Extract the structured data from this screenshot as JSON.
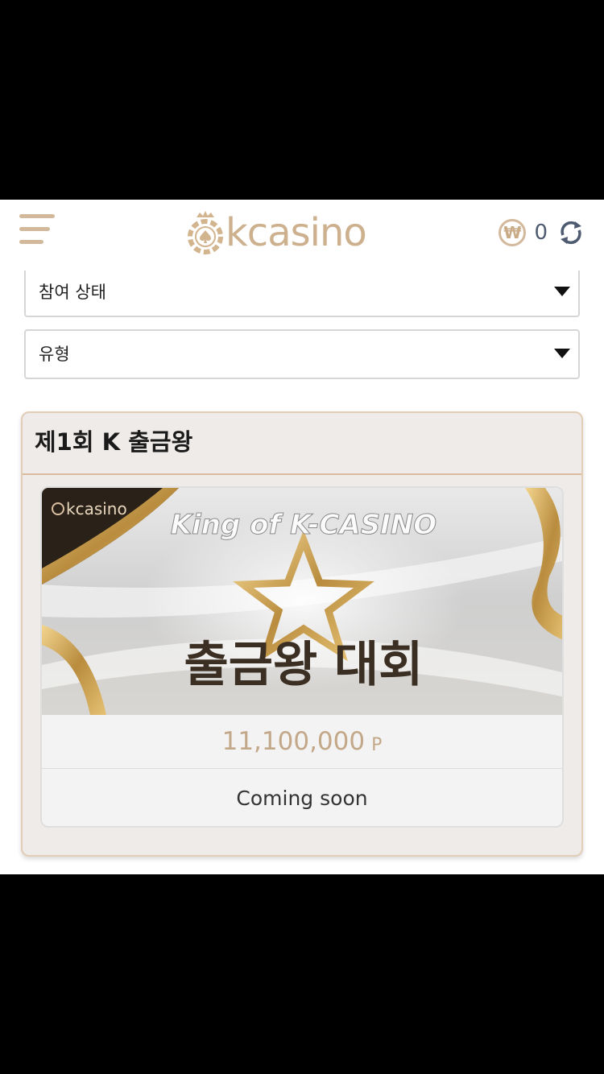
{
  "header": {
    "logo_text": "kcasino",
    "currency_symbol": "₩",
    "balance": "0"
  },
  "filters": [
    {
      "label": "참여 상태"
    },
    {
      "label": "유형"
    }
  ],
  "event": {
    "title": "제1회 K 출금왕",
    "banner": {
      "brand": "kcasino",
      "heading": "King of K-CASINO",
      "subheading": "출금왕 대회"
    },
    "prize_amount": "11,100,000",
    "prize_unit": "P",
    "status": "Coming soon"
  },
  "colors": {
    "accent_gold": "#cdb08d",
    "card_border": "#e2cdb7",
    "card_bg": "#efebe8",
    "balance_text": "#4d5a70"
  },
  "icons": [
    "menu-icon",
    "won-icon",
    "refresh-icon",
    "dropdown-arrow-icon",
    "star-icon"
  ]
}
